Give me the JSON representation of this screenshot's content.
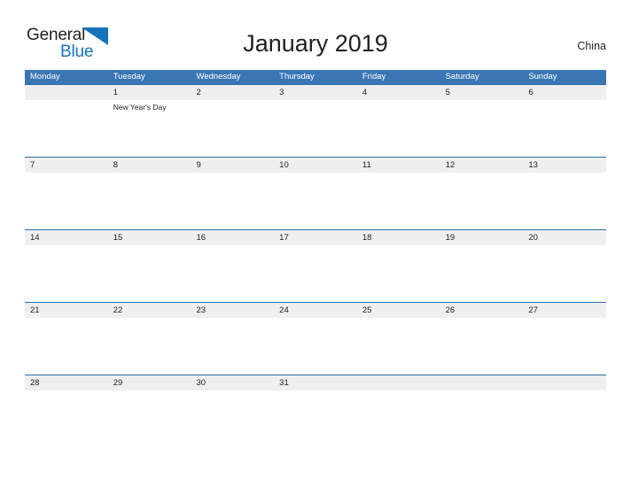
{
  "brand": {
    "name_part1": "General",
    "name_part2": "Blue",
    "triangle_icon": "blue-triangle-icon",
    "blue_hex": "#1573bb"
  },
  "header": {
    "title": "January 2019",
    "country": "China"
  },
  "colors": {
    "header_blue": "#3a76b4",
    "row_line_blue": "#2e6da4",
    "date_band_gray": "#efefef",
    "text_dark": "#231f20"
  },
  "calendar": {
    "weekdays": [
      "Monday",
      "Tuesday",
      "Wednesday",
      "Thursday",
      "Friday",
      "Saturday",
      "Sunday"
    ],
    "weeks": [
      {
        "days": [
          {
            "date": "",
            "event": ""
          },
          {
            "date": "1",
            "event": "New Year's Day"
          },
          {
            "date": "2",
            "event": ""
          },
          {
            "date": "3",
            "event": ""
          },
          {
            "date": "4",
            "event": ""
          },
          {
            "date": "5",
            "event": ""
          },
          {
            "date": "6",
            "event": ""
          }
        ]
      },
      {
        "days": [
          {
            "date": "7",
            "event": ""
          },
          {
            "date": "8",
            "event": ""
          },
          {
            "date": "9",
            "event": ""
          },
          {
            "date": "10",
            "event": ""
          },
          {
            "date": "11",
            "event": ""
          },
          {
            "date": "12",
            "event": ""
          },
          {
            "date": "13",
            "event": ""
          }
        ]
      },
      {
        "days": [
          {
            "date": "14",
            "event": ""
          },
          {
            "date": "15",
            "event": ""
          },
          {
            "date": "16",
            "event": ""
          },
          {
            "date": "17",
            "event": ""
          },
          {
            "date": "18",
            "event": ""
          },
          {
            "date": "19",
            "event": ""
          },
          {
            "date": "20",
            "event": ""
          }
        ]
      },
      {
        "days": [
          {
            "date": "21",
            "event": ""
          },
          {
            "date": "22",
            "event": ""
          },
          {
            "date": "23",
            "event": ""
          },
          {
            "date": "24",
            "event": ""
          },
          {
            "date": "25",
            "event": ""
          },
          {
            "date": "26",
            "event": ""
          },
          {
            "date": "27",
            "event": ""
          }
        ]
      },
      {
        "days": [
          {
            "date": "28",
            "event": ""
          },
          {
            "date": "29",
            "event": ""
          },
          {
            "date": "30",
            "event": ""
          },
          {
            "date": "31",
            "event": ""
          },
          {
            "date": "",
            "event": ""
          },
          {
            "date": "",
            "event": ""
          },
          {
            "date": "",
            "event": ""
          }
        ]
      }
    ]
  }
}
